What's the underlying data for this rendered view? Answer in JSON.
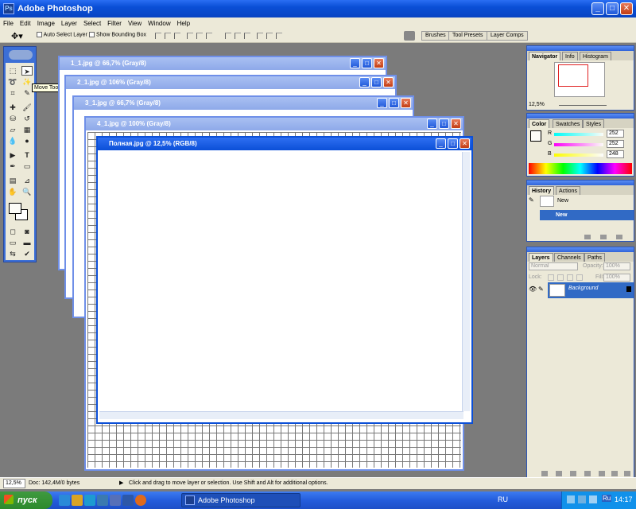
{
  "app": {
    "title": "Adobe Photoshop"
  },
  "menu": [
    "File",
    "Edit",
    "Image",
    "Layer",
    "Select",
    "Filter",
    "View",
    "Window",
    "Help"
  ],
  "options": {
    "auto_select": "Auto Select Layer",
    "show_bbox": "Show Bounding Box",
    "wells": [
      "Brushes",
      "Tool Presets",
      "Layer Comps"
    ]
  },
  "tooltip": "Move Tool (V)",
  "documents": [
    {
      "title": "1_1.jpg @ 66,7% (Gray/8)"
    },
    {
      "title": "2_1.jpg @ 106% (Gray/8)"
    },
    {
      "title": "3_1.jpg @ 66,7% (Gray/8)"
    },
    {
      "title": "4_1.jpg @ 100% (Gray/8)"
    },
    {
      "title": "Полная.jpg @ 12,5% (RGB/8)"
    }
  ],
  "navigator": {
    "tabs": [
      "Navigator",
      "Info",
      "Histogram"
    ],
    "zoom": "12,5%"
  },
  "color": {
    "tabs": [
      "Color",
      "Swatches",
      "Styles"
    ],
    "r": "252",
    "g": "252",
    "b": "248",
    "r_label": "R",
    "g_label": "G",
    "b_label": "B"
  },
  "history": {
    "tabs": [
      "History",
      "Actions"
    ],
    "snapshot": "New",
    "state": "New"
  },
  "layers": {
    "tabs": [
      "Layers",
      "Channels",
      "Paths"
    ],
    "blend": "Normal",
    "opacity_label": "Opacity:",
    "opacity": "100%",
    "lock_label": "Lock:",
    "fill_label": "Fill:",
    "fill": "100%",
    "layer_name": "Background"
  },
  "status": {
    "zoom": "12,5%",
    "doc": "Doc: 142,4M/0 bytes",
    "hint": "Click and drag to move layer or selection.  Use Shift and Alt for additional options."
  },
  "taskbar": {
    "start": "пуск",
    "task": "Adobe Photoshop",
    "lang": "RU",
    "lang2": "Ru",
    "clock": "14:17"
  },
  "colors": {
    "accent": "#0a4fd6",
    "start_green": "#2d8a2d",
    "selected_row": "#316ac5"
  }
}
